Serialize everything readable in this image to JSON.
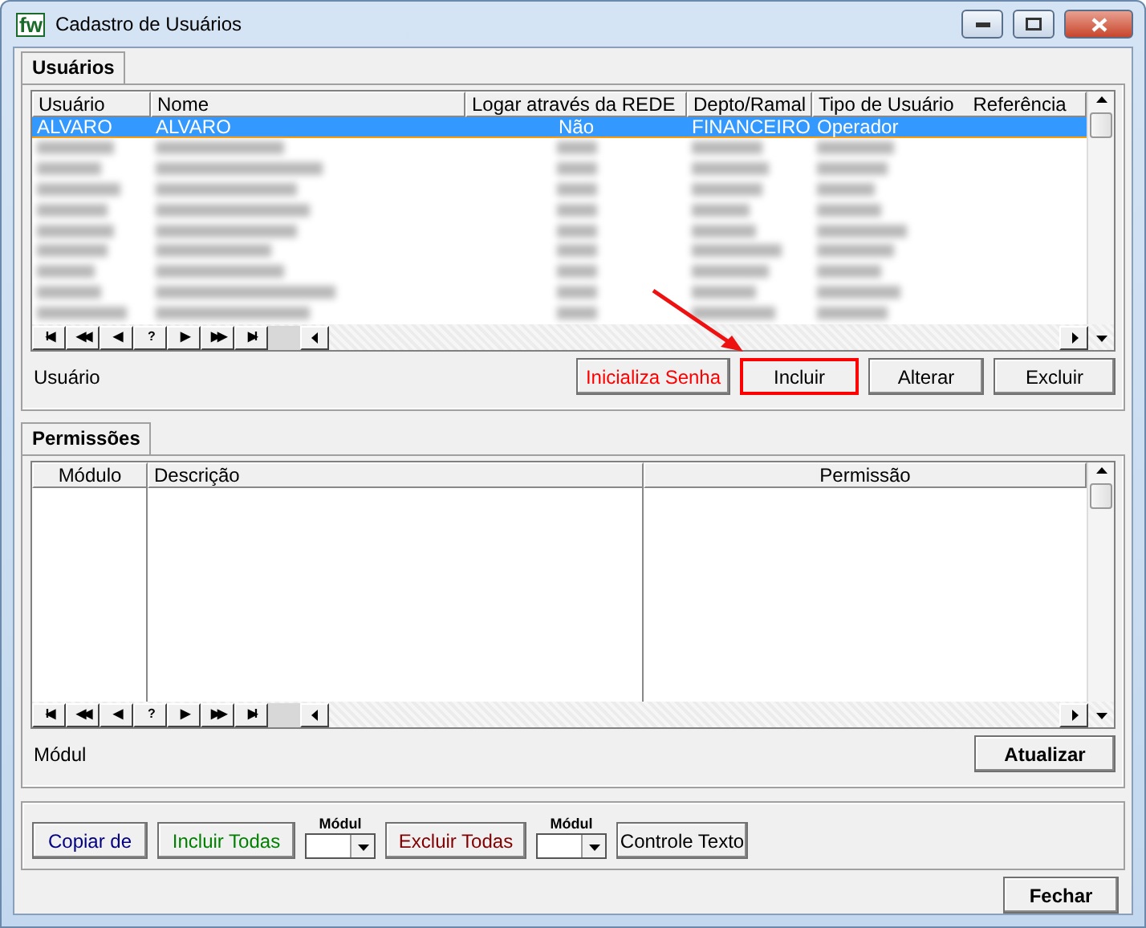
{
  "window": {
    "title": "Cadastro de Usuários",
    "logo": "fw"
  },
  "users_tab": {
    "label": "Usuários",
    "selected": true
  },
  "users_table": {
    "columns": [
      "Usuário",
      "Nome",
      "Logar através da REDE",
      "Depto/Ramal",
      "Tipo de Usuário",
      "Referência"
    ],
    "rows": [
      {
        "kind": "data",
        "selected": true,
        "cells": [
          "ALVARO",
          "ALVARO",
          "Não",
          "FINANCEIRO",
          "Operador",
          ""
        ]
      },
      {
        "kind": "redacted",
        "selected": false
      },
      {
        "kind": "redacted",
        "selected": false
      },
      {
        "kind": "redacted",
        "selected": false
      },
      {
        "kind": "redacted",
        "selected": false
      },
      {
        "kind": "redacted",
        "selected": false
      },
      {
        "kind": "redacted",
        "selected": false
      },
      {
        "kind": "redacted",
        "selected": false
      },
      {
        "kind": "redacted",
        "selected": false
      },
      {
        "kind": "redacted",
        "selected": false
      }
    ]
  },
  "users_nav": [
    "I◀",
    "◀◀",
    "◀",
    "?",
    "▶",
    "▶▶",
    "▶I"
  ],
  "users_label": "Usuário",
  "users_buttons": [
    {
      "label": "Inicializa Senha",
      "kind": "danger",
      "highlighted": false
    },
    {
      "label": "Incluir",
      "kind": "normal",
      "highlighted": true
    },
    {
      "label": "Alterar",
      "kind": "normal",
      "highlighted": false
    },
    {
      "label": "Excluir",
      "kind": "normal",
      "highlighted": false
    }
  ],
  "permissions_tab": {
    "label": "Permissões",
    "selected": true
  },
  "permissions_table": {
    "columns": [
      "Módulo",
      "Descrição",
      "Permissão"
    ]
  },
  "permissions_nav": [
    "I◀",
    "◀◀",
    "◀",
    "?",
    "▶",
    "▶▶",
    "▶I"
  ],
  "permissions_label": "Módul",
  "refresh_button": "Atualizar",
  "actions": [
    {
      "kind": "button",
      "label": "Copiar de",
      "color": "#000080"
    },
    {
      "kind": "button",
      "label": "Incluir Todas",
      "color": "#008000"
    },
    {
      "kind": "combo",
      "label": "Módul"
    },
    {
      "kind": "button",
      "label": "Excluir Todas",
      "color": "#800000"
    },
    {
      "kind": "combo",
      "label": "Módul"
    },
    {
      "kind": "button",
      "label": "Controle Texto",
      "color": "#000000"
    }
  ],
  "close_button": "Fechar"
}
